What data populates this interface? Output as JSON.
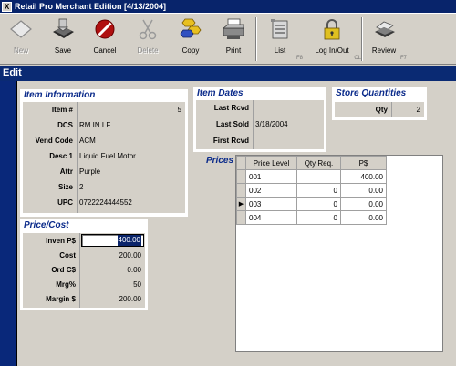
{
  "window": {
    "title": "Retail Pro Merchant Edition [4/13/2004]"
  },
  "toolbar": {
    "new": "New",
    "save": "Save",
    "cancel": "Cancel",
    "delete": "Delete",
    "copy": "Copy",
    "print": "Print",
    "list": "List",
    "list_key": "F8",
    "log": "Log In/Out",
    "log_key": "CL",
    "review": "Review",
    "review_key": "F7"
  },
  "mode": "Edit",
  "item_info": {
    "title": "Item Information",
    "fields": [
      {
        "label": "Item #",
        "value": "5"
      },
      {
        "label": "DCS",
        "value": "RM IN LF"
      },
      {
        "label": "Vend Code",
        "value": "ACM"
      },
      {
        "label": "Desc 1",
        "value": "Liquid Fuel Motor"
      },
      {
        "label": "Attr",
        "value": "Purple"
      },
      {
        "label": "Size",
        "value": "2"
      },
      {
        "label": "UPC",
        "value": "0722224444552"
      }
    ]
  },
  "item_dates": {
    "title": "Item Dates",
    "fields": [
      {
        "label": "Last Rcvd",
        "value": ""
      },
      {
        "label": "Last Sold",
        "value": "3/18/2004"
      },
      {
        "label": "First Rcvd",
        "value": ""
      }
    ]
  },
  "store_qty": {
    "title": "Store Quantities",
    "label": "Qty",
    "value": "2"
  },
  "price_cost": {
    "title": "Price/Cost",
    "fields": [
      {
        "label": "Inven P$",
        "value": "400.00"
      },
      {
        "label": "Cost",
        "value": "200.00"
      },
      {
        "label": "Ord C$",
        "value": "0.00"
      },
      {
        "label": "Mrg%",
        "value": "50"
      },
      {
        "label": "Margin $",
        "value": "200.00"
      }
    ]
  },
  "prices": {
    "title": "Prices",
    "headers": [
      "Price Level",
      "Qty Req.",
      "P$"
    ],
    "rows": [
      {
        "level": "001",
        "qty": "",
        "price": "400.00"
      },
      {
        "level": "002",
        "qty": "0",
        "price": "0.00"
      },
      {
        "level": "003",
        "qty": "0",
        "price": "0.00"
      },
      {
        "level": "004",
        "qty": "0",
        "price": "0.00"
      }
    ],
    "current_row_marker": "▶"
  },
  "colors": {
    "title_bar": "#08246b",
    "edit_bar": "#0a2a73",
    "panel_title": "#0a2a8a",
    "face": "#d4d0c8"
  }
}
